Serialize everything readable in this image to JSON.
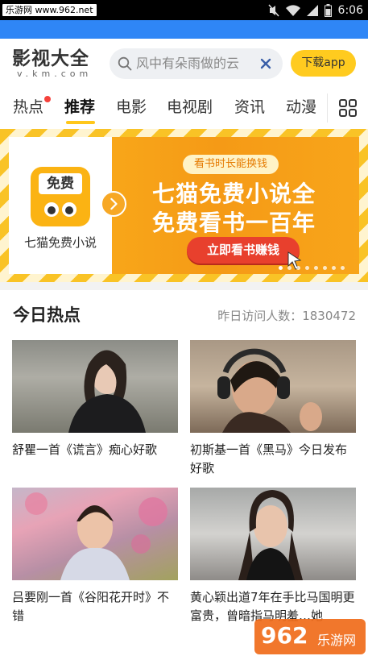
{
  "status_bar": {
    "site_label": "乐游网 www.962.net",
    "time": "6:06"
  },
  "header": {
    "logo_main": "影视大全",
    "logo_sub": "v.km.com",
    "search_placeholder": "风中有朵雨做的云",
    "download_label": "下载app"
  },
  "tabs": [
    {
      "label": "热点",
      "badge": true
    },
    {
      "label": "推荐",
      "active": true
    },
    {
      "label": "电影"
    },
    {
      "label": "电视剧"
    },
    {
      "label": "资讯"
    },
    {
      "label": "动漫"
    }
  ],
  "banner": {
    "app_icon_text": "免费",
    "app_name": "七猫免费小说",
    "tag": "看书时长能换钱",
    "title_line1": "七猫免费小说全",
    "title_line2": "免费看书一百年",
    "button": "立即看书赚钱",
    "pager_count": 8,
    "pager_active": 0
  },
  "hot": {
    "title": "今日热点",
    "visitors": "昨日访问人数：1830472",
    "items": [
      {
        "caption": "舒瞿一首《谎言》痴心好歌"
      },
      {
        "caption": "初斯基一首《黑马》今日发布好歌"
      },
      {
        "caption": "吕要刚一首《谷阳花开时》不错"
      },
      {
        "caption": "黄心颖出道7年在手比马国明更富贵，曾暗指马明羞…她"
      }
    ]
  },
  "watermark": {
    "text": "962",
    "sub": "乐游网"
  },
  "colors": {
    "accent_blue": "#2f86f6",
    "accent_yellow": "#ffcb1f",
    "banner_red": "#e8402d",
    "badge_red": "#f5423c"
  }
}
